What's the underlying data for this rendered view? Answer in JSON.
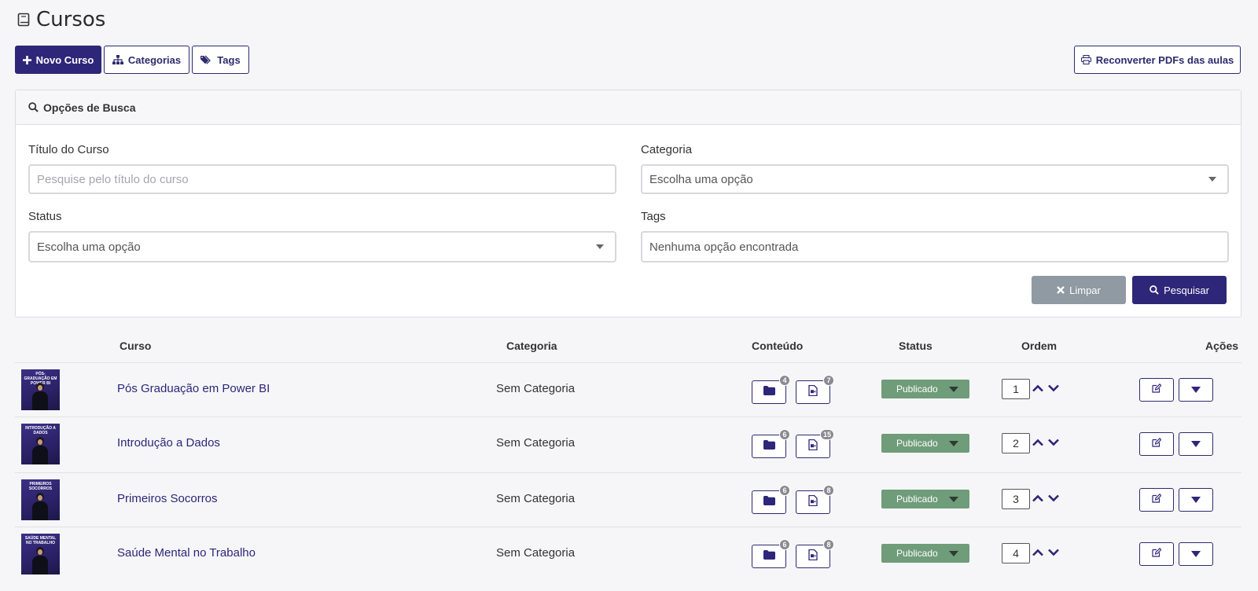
{
  "page": {
    "title": "Cursos"
  },
  "toolbar": {
    "new_course": "Novo Curso",
    "categories": "Categorias",
    "tags": "Tags",
    "reconvert": "Reconverter PDFs das aulas"
  },
  "search": {
    "panel_title": "Opções de Busca",
    "title_label": "Título do Curso",
    "title_placeholder": "Pesquise pelo título do curso",
    "category_label": "Categoria",
    "category_value": "Escolha uma opção",
    "status_label": "Status",
    "status_value": "Escolha uma opção",
    "tags_label": "Tags",
    "tags_value": "Nenhuma opção encontrada",
    "clear": "Limpar",
    "submit": "Pesquisar"
  },
  "table": {
    "headers": {
      "course": "Curso",
      "category": "Categoria",
      "content": "Conteúdo",
      "status": "Status",
      "order": "Ordem",
      "actions": "Ações"
    },
    "rows": [
      {
        "thumb_text": "PÓS-GRADUAÇÃO EM POWER BI",
        "name": "Pós Graduação em Power BI",
        "category": "Sem Categoria",
        "folders": "4",
        "lessons": "7",
        "status": "Publicado",
        "order": "1"
      },
      {
        "thumb_text": "INTRODUÇÃO A DADOS",
        "name": "Introdução a Dados",
        "category": "Sem Categoria",
        "folders": "6",
        "lessons": "15",
        "status": "Publicado",
        "order": "2"
      },
      {
        "thumb_text": "PRIMEIROS SOCORROS",
        "name": "Primeiros Socorros",
        "category": "Sem Categoria",
        "folders": "6",
        "lessons": "8",
        "status": "Publicado",
        "order": "3"
      },
      {
        "thumb_text": "SAÚDE MENTAL NO TRABALHO",
        "name": "Saúde Mental no Trabalho",
        "category": "Sem Categoria",
        "folders": "6",
        "lessons": "8",
        "status": "Publicado",
        "order": "4"
      }
    ]
  },
  "colors": {
    "primary": "#2e2679",
    "status_published": "#6f9c79",
    "clear_button": "#8f9aa3"
  },
  "icons": {
    "title": "book-icon",
    "new": "plus-icon",
    "categories": "sitemap-icon",
    "tags": "tags-icon",
    "reconvert": "printer-icon",
    "search": "search-icon",
    "clear": "times-icon",
    "folder": "folder-icon",
    "lesson": "file-video-icon",
    "up": "chevron-up-icon",
    "down": "chevron-down-icon",
    "edit": "edit-icon",
    "dropdown": "caret-down-icon"
  }
}
